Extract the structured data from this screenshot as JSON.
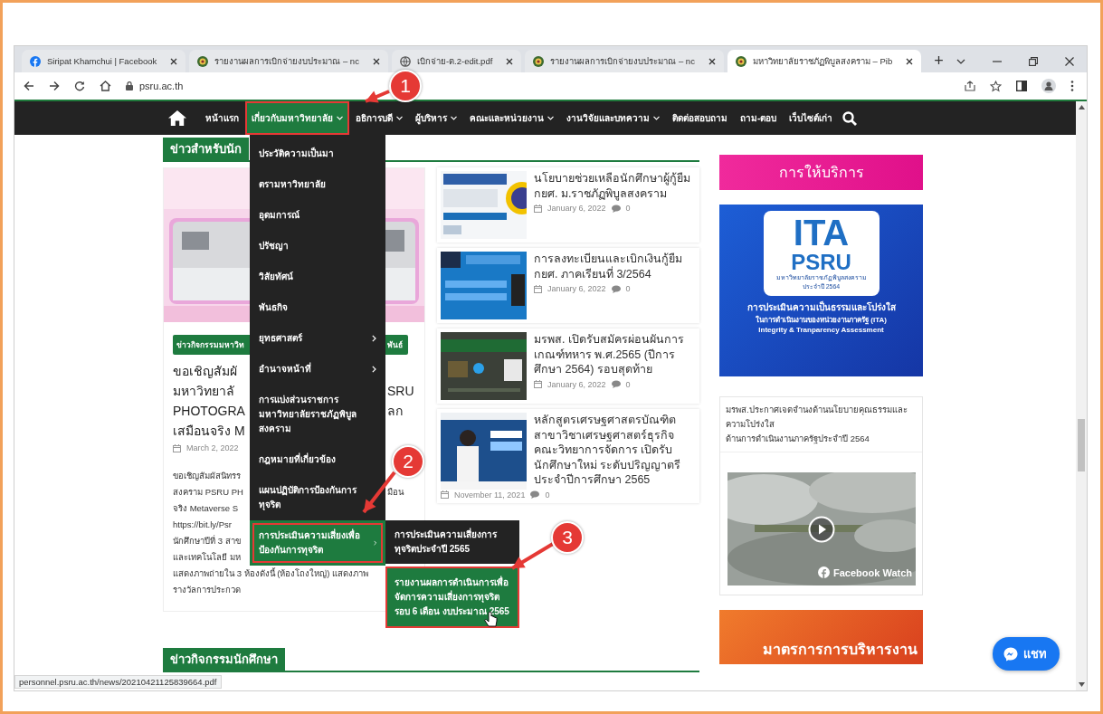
{
  "browser": {
    "tabs": [
      {
        "title": "Siripat Khamchui | Facebook",
        "kind": "facebook",
        "selected": false
      },
      {
        "title": "รายงานผลการเบิกจ่ายงบประมาณ – nc",
        "kind": "seal",
        "selected": false
      },
      {
        "title": "เบิกจ่าย-ต.2-edit.pdf",
        "kind": "globe",
        "selected": false
      },
      {
        "title": "รายงานผลการเบิกจ่ายงบประมาณ – nc",
        "kind": "seal",
        "selected": false
      },
      {
        "title": "มหาวิทยาลัยราชภัฏพิบูลสงคราม – Pib",
        "kind": "seal",
        "selected": true
      }
    ],
    "new_tab": "+",
    "address": "psru.ac.th"
  },
  "nav": {
    "items": [
      {
        "label": "หน้าแรก",
        "menu": false,
        "selected": false
      },
      {
        "label": "เกี่ยวกับมหาวิทยาลัย",
        "menu": true,
        "selected": true
      },
      {
        "label": "อธิการบดี",
        "menu": true,
        "selected": false
      },
      {
        "label": "ผู้บริหาร",
        "menu": true,
        "selected": false
      },
      {
        "label": "คณะและหน่วยงาน",
        "menu": true,
        "selected": false
      },
      {
        "label": "งานวิจัยและบทความ",
        "menu": true,
        "selected": false
      },
      {
        "label": "ติดต่อสอบถาม",
        "menu": false,
        "selected": false
      },
      {
        "label": "ถาม-ตอบ",
        "menu": false,
        "selected": false
      },
      {
        "label": "เว็บไซต์เก่า",
        "menu": false,
        "selected": false
      }
    ]
  },
  "dropdown": {
    "items": [
      {
        "label": "ประวัติความเป็นมา",
        "submenu": false,
        "selected": false
      },
      {
        "label": "ตรามหาวิทยาลัย",
        "submenu": false,
        "selected": false
      },
      {
        "label": "อุดมการณ์",
        "submenu": false,
        "selected": false
      },
      {
        "label": "ปรัชญา",
        "submenu": false,
        "selected": false
      },
      {
        "label": "วิสัยทัศน์",
        "submenu": false,
        "selected": false
      },
      {
        "label": "พันธกิจ",
        "submenu": false,
        "selected": false
      },
      {
        "label": "ยุทธศาสตร์",
        "submenu": true,
        "selected": false
      },
      {
        "label": "อำนาจหน้าที่",
        "submenu": true,
        "selected": false
      },
      {
        "label": "การแบ่งส่วนราชการมหาวิทยาลัยราชภัฏพิบูลสงคราม",
        "submenu": false,
        "selected": false
      },
      {
        "label": "กฎหมายที่เกี่ยวข้อง",
        "submenu": false,
        "selected": false
      },
      {
        "label": "แผนปฏิบัติการป้องกันการทุจริต",
        "submenu": false,
        "selected": false
      },
      {
        "label": "การประเมินความเสี่ยงเพื่อป้องกันการทุจริต",
        "submenu": true,
        "selected": true
      }
    ],
    "submenu_items": [
      {
        "label": "การประเมินความเสี่ยงการทุจริตประจำปี 2565",
        "selected": false
      },
      {
        "label": "รายงานผลการดำเนินการเพื่อจัดการความเสี่ยงการทุจริตรอบ 6 เดือน งบประมาณ 2565",
        "selected": true
      }
    ]
  },
  "left_story": {
    "heading": "ข่าวสำหรับนัก",
    "tag": {
      "left": "ข่าวกิจกรรมมหาวิท",
      "right": "พันธ์"
    },
    "title_lines": [
      {
        "left": "ขอเชิญสัมผั"
      },
      {
        "left": "มหาวิทยาลั",
        "right": "SRU"
      },
      {
        "left": "PHOTOGRA",
        "right": "ลก"
      },
      {
        "left": "เสมือนจริง M"
      }
    ],
    "date": "March 2, 2022",
    "body_lines": [
      {
        "left": "ขอเชิญสัมผัสนิทรร"
      },
      {
        "left": "สงคราม PSRU PH",
        "right": "มือน"
      },
      {
        "left": "จริง Metaverse S"
      },
      {
        "left": "https://bit.ly/Psr"
      },
      {
        "left": "นักศึกษาปีที่ 3 สาข"
      },
      {
        "left": "และเทคโนโลยี มห"
      },
      {
        "left": "แสดงภาพถ่ายใน 3 ห้องดังนี้ (ห้องโถงใหญ่) แสดงภาพ"
      },
      {
        "left": "รางวัลการประกวด"
      }
    ]
  },
  "news_cards": [
    {
      "title": "นโยบายช่วยเหลือนักศึกษาผู้กู้ยืม กยศ. ม.ราชภัฏพิบูลสงคราม",
      "date": "January 6, 2022",
      "comments": "0"
    },
    {
      "title": "การลงทะเบียนและเบิกเงินกู้ยืม กยศ. ภาคเรียนที่ 3/2564",
      "date": "January 6, 2022",
      "comments": "0"
    },
    {
      "title": "มรพส. เปิดรับสมัครผ่อนผันการเกณฑ์ทหาร พ.ศ.2565 (ปีการศึกษา 2564) รอบสุดท้าย",
      "date": "January 6, 2022",
      "comments": "0"
    },
    {
      "title": "หลักสูตรเศรษฐศาสตรบัณฑิต สาขาวิชาเศรษฐศาสตร์ธุรกิจ คณะวิทยาการจัดการ เปิดรับนักศึกษาใหม่ ระดับปริญญาตรี ประจำปีการศึกษา 2565",
      "date": "November 11, 2021",
      "comments": "0"
    }
  ],
  "bottom_heading": "ข่าวกิจกรรมนักศึกษา",
  "sidebar": {
    "service_heading": "การให้บริการ",
    "ita_banner": {
      "logo": "ITA",
      "name": "PSRU",
      "university": "มหาวิทยาลัยราชภัฏพิบูลสงคราม",
      "year": "ประจำปี 2564",
      "line_1": "การประเมินความเป็นธรรมและโปร่งใส",
      "line_2": "ในการดำเนินงานของหน่วยงานภาครัฐ (ITA)",
      "line_3": "Integrity & Tranparency Assessment"
    },
    "notice": [
      "มรพส.ประกาศเจตจำนงด้านนโยบายคุณธรรมและความโปร่งใส",
      "ด้านการดำเนินงานภาครัฐประจำปี 2564"
    ],
    "video_label": "Facebook Watch",
    "bottom_banner": "มาตรการการบริหารงาน"
  },
  "status_bar": "personnel.psru.ac.th/news/20210421125839664.pdf",
  "chat_button": "แชท",
  "annotations": [
    {
      "number": "1"
    },
    {
      "number": "2"
    },
    {
      "number": "3"
    }
  ]
}
